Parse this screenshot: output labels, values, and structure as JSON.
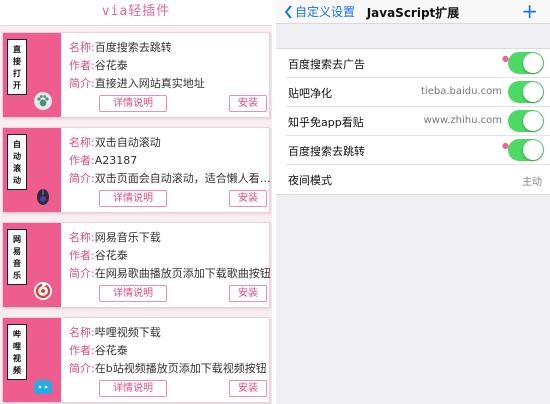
{
  "left_panel": {
    "title": "via轻插件",
    "label_name": "名称:",
    "label_author": "作者:",
    "label_desc": "简介:",
    "detail_button": "详情说明",
    "install_button": "安装",
    "accent_color": "#ef5c8e",
    "cards": [
      {
        "tag": "直\n接\n打\n开",
        "icon": "paw-icon",
        "name": "百度搜索去跳转",
        "author": "谷花泰",
        "desc": "直接进入网站真实地址"
      },
      {
        "tag": "自\n动\n滚\n动",
        "icon": "mouse-icon",
        "name": "双击自动滚动",
        "author": "A23187",
        "desc": "双击页面会自动滚动，适合懒人看…"
      },
      {
        "tag": "网\n易\n音\n乐",
        "icon": "netease-music-icon",
        "name": "网易音乐下载",
        "author": "谷花泰",
        "desc": "在网易歌曲播放页添加下载歌曲按钮"
      },
      {
        "tag": "哔\n哩\n视\n频",
        "icon": "bilibili-icon",
        "name": "哔哩视频下载",
        "author": "谷花泰",
        "desc": "在b站视频播放页添加下载视频按钮"
      }
    ]
  },
  "right_panel": {
    "nav": {
      "back_label": "自定义设置",
      "title": "JavaScript扩展",
      "add_label": "+"
    },
    "toggle_color": "#4cd964",
    "rows": [
      {
        "name": "百度搜索去广告",
        "host": "",
        "toggle": true
      },
      {
        "name": "贴吧净化",
        "host": "tieba.baidu.com",
        "toggle": true
      },
      {
        "name": "知乎免app看贴",
        "host": "www.zhihu.com",
        "toggle": true
      },
      {
        "name": "百度搜索去跳转",
        "host": "",
        "toggle": true
      },
      {
        "name": "夜间模式",
        "value": "主动",
        "toggle": false
      }
    ]
  }
}
